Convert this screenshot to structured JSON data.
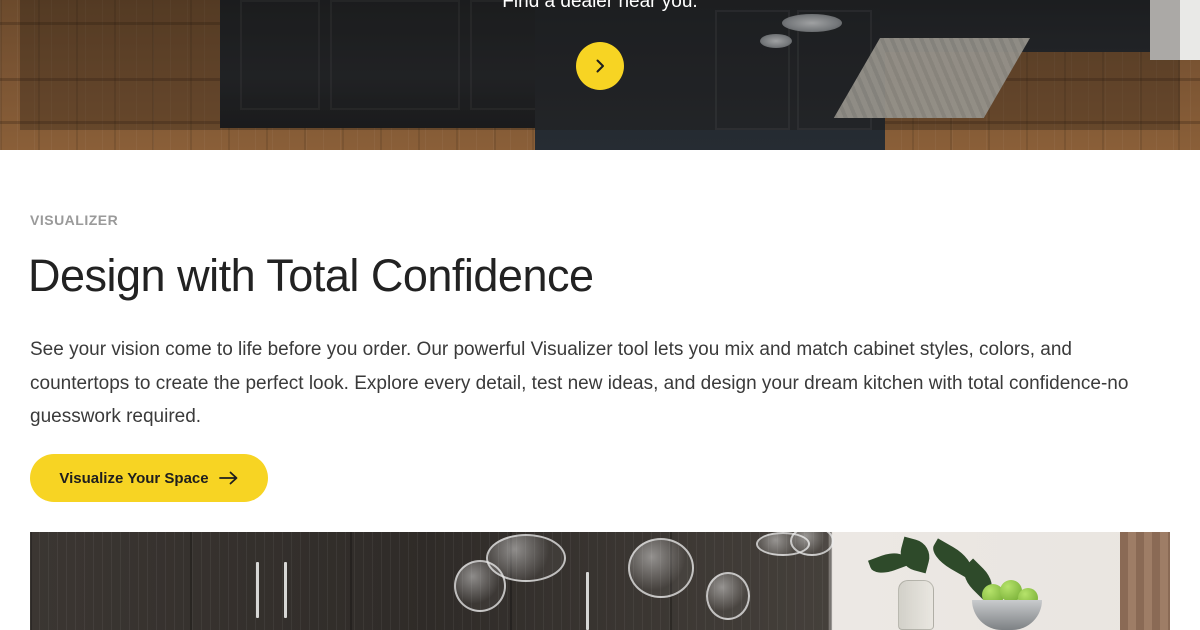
{
  "hero": {
    "text": "Find a dealer near you.",
    "arrow_icon": "chevron-right-icon",
    "accent_color": "#f7d423"
  },
  "visualizer": {
    "eyebrow": "VISUALIZER",
    "title": "Design with Total Confidence",
    "body": "See your vision come to life before you order. Our powerful Visualizer tool lets you mix and match cabinet styles, colors, and countertops to create the perfect look. Explore every detail, test new ideas, and design your dream kitchen with total confidence-no guesswork required.",
    "cta_label": "Visualize Your Space",
    "cta_icon": "arrow-right-icon"
  }
}
